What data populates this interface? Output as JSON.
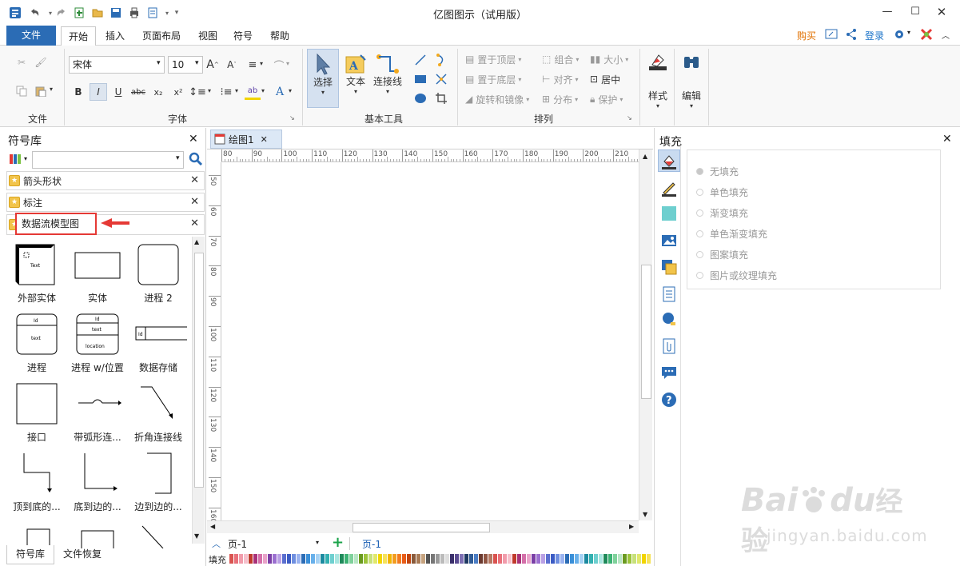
{
  "app": {
    "title": "亿图图示（试用版）"
  },
  "menu": {
    "tabs": [
      "文件",
      "开始",
      "插入",
      "页面布局",
      "视图",
      "符号",
      "帮助"
    ],
    "right": {
      "buy": "购买",
      "login": "登录"
    }
  },
  "ribbon": {
    "groups": {
      "file": "文件",
      "font": "字体",
      "basic_tools": "基本工具",
      "arrange": "排列"
    },
    "font": {
      "family": "宋体",
      "size": "10"
    },
    "tools": {
      "select": "选择",
      "text": "文本",
      "connector": "连接线"
    },
    "arrange": {
      "to_top": "置于顶层",
      "to_bottom": "置于底层",
      "rotate": "旋转和镜像",
      "group": "组合",
      "align": "对齐",
      "distribute": "分布",
      "size": "大小",
      "center": "居中",
      "protect": "保护"
    },
    "style": "样式",
    "edit": "编辑"
  },
  "library": {
    "title": "符号库",
    "search_placeholder": "",
    "categories": [
      "箭头形状",
      "标注",
      "数据流模型图"
    ],
    "shapes": [
      {
        "label": "外部实体",
        "inner": "Text"
      },
      {
        "label": "实体"
      },
      {
        "label": "进程 2"
      },
      {
        "label": "进程",
        "inner_top": "Id",
        "inner": "text"
      },
      {
        "label": "进程 w/位置",
        "inner_top": "Id",
        "inner": "text",
        "inner_bottom": "location"
      },
      {
        "label": "数据存储",
        "inner": "Id"
      },
      {
        "label": "接口"
      },
      {
        "label": "带弧形连..."
      },
      {
        "label": "折角连接线"
      },
      {
        "label": "顶到底的..."
      },
      {
        "label": "底到边的..."
      },
      {
        "label": "边到边的..."
      }
    ],
    "bottom_tabs": [
      "符号库",
      "文件恢复"
    ]
  },
  "document": {
    "tab": "绘图1",
    "ruler_h": [
      "80",
      "90",
      "100",
      "110",
      "120",
      "130",
      "140",
      "150",
      "160",
      "170",
      "180",
      "190",
      "200",
      "210"
    ],
    "ruler_v": [
      "50",
      "60",
      "70",
      "80",
      "90",
      "100",
      "110",
      "120",
      "130",
      "140",
      "150",
      "160"
    ],
    "page_select": "页-1",
    "page_tab": "页-1",
    "fill_label": "填充"
  },
  "fill_panel": {
    "title": "填充",
    "options": [
      "无填充",
      "单色填充",
      "渐变填充",
      "单色渐变填充",
      "图案填充",
      "图片或纹理填充"
    ],
    "selected": 0
  },
  "watermark": {
    "line1": "Bai",
    "line1b": "du",
    "line1c": "经验",
    "line2": "jingyan.baidu.com"
  },
  "colors": {
    "accent": "#2b6cb5",
    "red_arrow": "#e53935",
    "teal": "#6ecfcf",
    "link": "#1a73c9",
    "buy": "#e07000"
  }
}
